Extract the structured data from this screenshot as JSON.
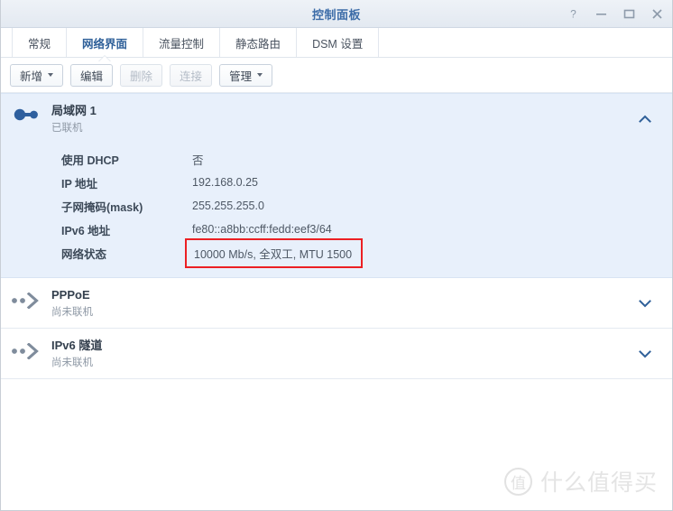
{
  "window": {
    "title": "控制面板",
    "controls": [
      {
        "name": "help-button",
        "glyph": "?"
      },
      {
        "name": "minimize-button",
        "glyph": "—"
      },
      {
        "name": "maximize-button",
        "glyph": "□"
      },
      {
        "name": "close-button",
        "glyph": "✕"
      }
    ]
  },
  "tabs": [
    {
      "label": "常规",
      "active": false
    },
    {
      "label": "网络界面",
      "active": true
    },
    {
      "label": "流量控制",
      "active": false
    },
    {
      "label": "静态路由",
      "active": false
    },
    {
      "label": "DSM 设置",
      "active": false
    }
  ],
  "toolbar": {
    "buttons": [
      {
        "label": "新增",
        "dropdown": true,
        "disabled": false
      },
      {
        "label": "编辑",
        "dropdown": false,
        "disabled": false
      },
      {
        "label": "删除",
        "dropdown": false,
        "disabled": true
      },
      {
        "label": "连接",
        "dropdown": false,
        "disabled": true
      },
      {
        "label": "管理",
        "dropdown": true,
        "disabled": false
      }
    ]
  },
  "interfaces": [
    {
      "name": "局域网 1",
      "status": "已联机",
      "expanded": true,
      "icon": "lan-link-icon",
      "chevron": "chevron-up-icon",
      "details": [
        {
          "label": "使用 DHCP",
          "value": "否",
          "highlight": false
        },
        {
          "label": "IP 地址",
          "value": "192.168.0.25",
          "highlight": false
        },
        {
          "label": "子网掩码(mask)",
          "value": "255.255.255.0",
          "highlight": false
        },
        {
          "label": "IPv6 地址",
          "value": "fe80::a8bb:ccff:fedd:eef3/64",
          "highlight": false
        },
        {
          "label": "网络状态",
          "value": "10000 Mb/s, 全双工, MTU 1500",
          "highlight": true
        }
      ]
    },
    {
      "name": "PPPoE",
      "status": "尚未联机",
      "expanded": false,
      "icon": "pppoe-arrow-icon",
      "chevron": "chevron-down-icon",
      "details": []
    },
    {
      "name": "IPv6 隧道",
      "status": "尚未联机",
      "expanded": false,
      "icon": "tunnel-arrow-icon",
      "chevron": "chevron-down-icon",
      "details": []
    }
  ],
  "watermark": {
    "logo_char": "值",
    "text": "什么值得买"
  },
  "colors": {
    "accent": "#3c6ca8",
    "highlight_box": "#ec2024",
    "panel_selected_bg": "#e8f0fb"
  }
}
